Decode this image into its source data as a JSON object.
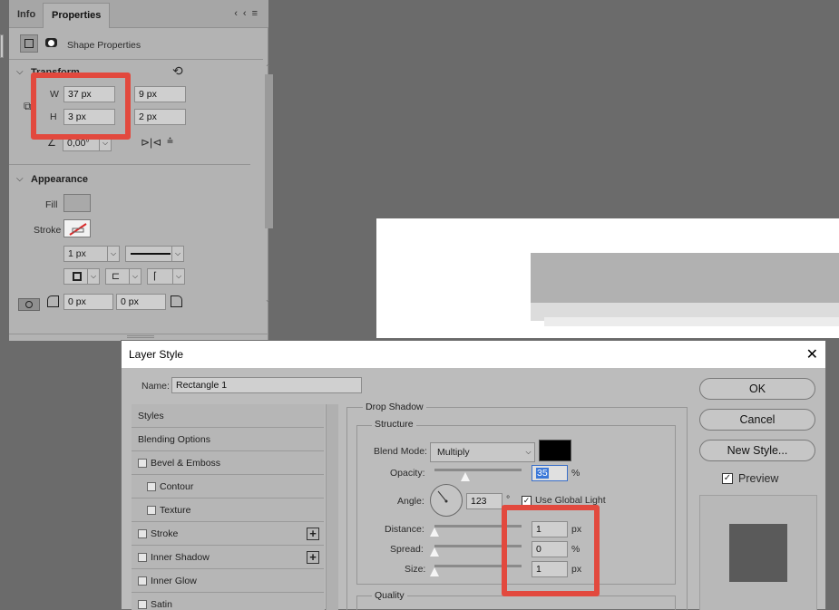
{
  "properties_panel": {
    "tabs": [
      {
        "label": "Info"
      },
      {
        "label": "Properties"
      }
    ],
    "shape_properties_label": "Shape Properties",
    "transform": {
      "section_label": "Transform",
      "w_label": "W",
      "h_label": "H",
      "w_value": "37 px",
      "h_value": "3 px",
      "x_value": "9 px",
      "y_value": "2 px",
      "angle_value": "0,00°"
    },
    "appearance": {
      "section_label": "Appearance",
      "fill_label": "Fill",
      "stroke_label": "Stroke",
      "stroke_width": "1 px",
      "corner_radius_1": "0 px",
      "corner_radius_2": "0 px"
    }
  },
  "dialog": {
    "title": "Layer Style",
    "name_label": "Name:",
    "name_value": "Rectangle 1",
    "styles": [
      {
        "label": "Styles",
        "checkbox": false,
        "plus": false,
        "indent": false
      },
      {
        "label": "Blending Options",
        "checkbox": false,
        "plus": false,
        "indent": false
      },
      {
        "label": "Bevel & Emboss",
        "checkbox": true,
        "plus": false,
        "indent": false
      },
      {
        "label": "Contour",
        "checkbox": true,
        "plus": false,
        "indent": true
      },
      {
        "label": "Texture",
        "checkbox": true,
        "plus": false,
        "indent": true
      },
      {
        "label": "Stroke",
        "checkbox": true,
        "plus": true,
        "indent": false
      },
      {
        "label": "Inner Shadow",
        "checkbox": true,
        "plus": true,
        "indent": false
      },
      {
        "label": "Inner Glow",
        "checkbox": true,
        "plus": false,
        "indent": false
      },
      {
        "label": "Satin",
        "checkbox": true,
        "plus": false,
        "indent": false
      }
    ],
    "drop_shadow": {
      "group_label": "Drop Shadow",
      "structure_label": "Structure",
      "blend_mode_label": "Blend Mode:",
      "blend_mode_value": "Multiply",
      "shadow_color": "#000000",
      "opacity_label": "Opacity:",
      "opacity_value": "35",
      "opacity_unit": "%",
      "angle_label": "Angle:",
      "angle_value": "123",
      "angle_unit": "°",
      "use_global_light_label": "Use Global Light",
      "use_global_light": true,
      "distance_label": "Distance:",
      "distance_value": "1",
      "distance_unit": "px",
      "spread_label": "Spread:",
      "spread_value": "0",
      "spread_unit": "%",
      "size_label": "Size:",
      "size_value": "1",
      "size_unit": "px",
      "quality_label": "Quality"
    },
    "buttons": {
      "ok": "OK",
      "cancel": "Cancel",
      "new_style": "New Style...",
      "preview_label": "Preview",
      "preview_checked": true
    }
  },
  "colors": {
    "highlight_box": "#e2493e",
    "panel_bg": "#b3b3b3",
    "app_bg": "#6b6b6b"
  }
}
